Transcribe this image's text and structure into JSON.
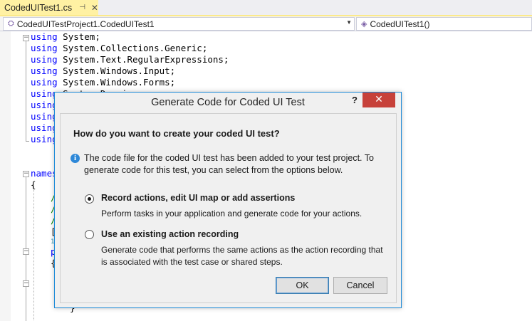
{
  "tab": {
    "title": "CodedUITest1.cs",
    "pin_icon": "pin-icon",
    "close_icon": "close-icon"
  },
  "navbar": {
    "project_combo": "CodedUITestProject1.CodedUITest1",
    "member_combo": "CodedUITest1()"
  },
  "code": {
    "lines": [
      {
        "kw": "using",
        "text": " System;"
      },
      {
        "kw": "using",
        "text": " System.Collections.Generic;"
      },
      {
        "kw": "using",
        "text": " System.Text.RegularExpressions;"
      },
      {
        "kw": "using",
        "text": " System.Windows.Input;"
      },
      {
        "kw": "using",
        "text": " System.Windows.Forms;"
      },
      {
        "kw": "using",
        "text": " System.Drawing;"
      },
      {
        "kw": "using",
        "text": ""
      },
      {
        "kw": "using",
        "text": ""
      },
      {
        "kw": "using",
        "text": ""
      },
      {
        "kw": "using",
        "text": ""
      }
    ],
    "namespace_kw": "names",
    "brace_open": "{",
    "brace_close": "}",
    "comment_mark": "/",
    "bracket": "[",
    "ref_count": "1",
    "p_mark": "p",
    "inner_brace": "{"
  },
  "dialog": {
    "title": "Generate Code for Coded UI Test",
    "help": "?",
    "close": "✕",
    "question": "How do you want to create your coded UI test?",
    "info_icon": "i",
    "info_text": "The code file for the coded UI test has been added to your test project. To generate code for this test, you can select from the options below.",
    "options": [
      {
        "label": "Record actions, edit UI map or add assertions",
        "description": "Perform tasks in your application and generate code for your actions.",
        "selected": true
      },
      {
        "label": "Use an existing action recording",
        "description": "Generate code that performs the same actions as the action recording that is associated with the test case or shared steps.",
        "selected": false
      }
    ],
    "ok_label": "OK",
    "cancel_label": "Cancel"
  },
  "colors": {
    "keyword": "#0000ff",
    "comment": "#008000",
    "tab_active": "#fff1a3",
    "close_button": "#c7413a",
    "dialog_border": "#1c8ad8"
  }
}
